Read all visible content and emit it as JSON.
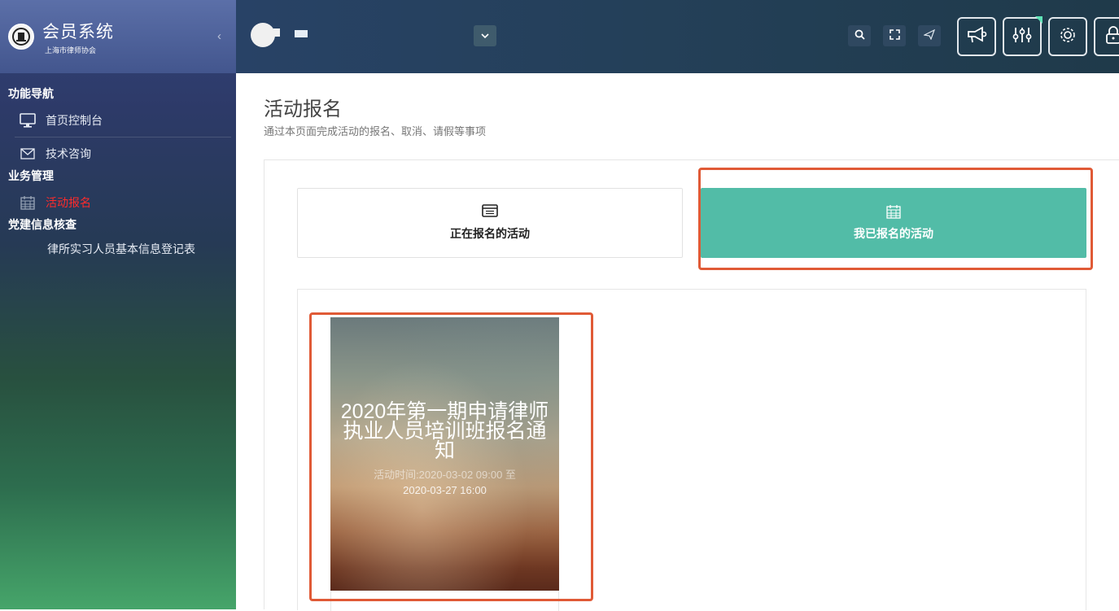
{
  "brand": {
    "title": "会员系统",
    "subtitle": "上海市律师协会",
    "logo_icon": "lawyer-emblem-icon",
    "collapse_glyph": "‹"
  },
  "sidebar": {
    "sections": [
      {
        "label": "功能导航"
      },
      {
        "label": "业务管理"
      },
      {
        "label": "党建信息核查"
      }
    ],
    "items": [
      {
        "label": "首页控制台",
        "icon": "monitor-icon"
      },
      {
        "label": "技术咨询",
        "icon": "envelope-icon"
      },
      {
        "label": "活动报名",
        "icon": "calendar-icon",
        "active": true
      },
      {
        "label": "律所实习人员基本信息登记表"
      }
    ],
    "active_color": "#ff2b2b"
  },
  "topbar": {
    "tools": [
      {
        "icon": "search-icon"
      },
      {
        "icon": "fullscreen-icon"
      },
      {
        "icon": "send-icon"
      },
      {
        "icon": "megaphone-icon"
      },
      {
        "icon": "sliders-icon"
      },
      {
        "icon": "gear-icon"
      },
      {
        "icon": "lock-icon"
      }
    ]
  },
  "page": {
    "title": "活动报名",
    "description": "通过本页面完成活动的报名、取消、请假等事项"
  },
  "tabs": [
    {
      "label": "正在报名的活动",
      "icon": "list-icon",
      "active": false
    },
    {
      "label": "我已报名的活动",
      "icon": "calendar-icon",
      "active": true
    }
  ],
  "activity_card": {
    "title": "2020年第一期申请律师执业人员培训班报名通知",
    "time_line1": "活动时间:2020-03-02 09:00 至",
    "time_line2": "2020-03-27 16:00"
  },
  "colors": {
    "accent": "#52bca7",
    "highlight": "#e05a36"
  }
}
